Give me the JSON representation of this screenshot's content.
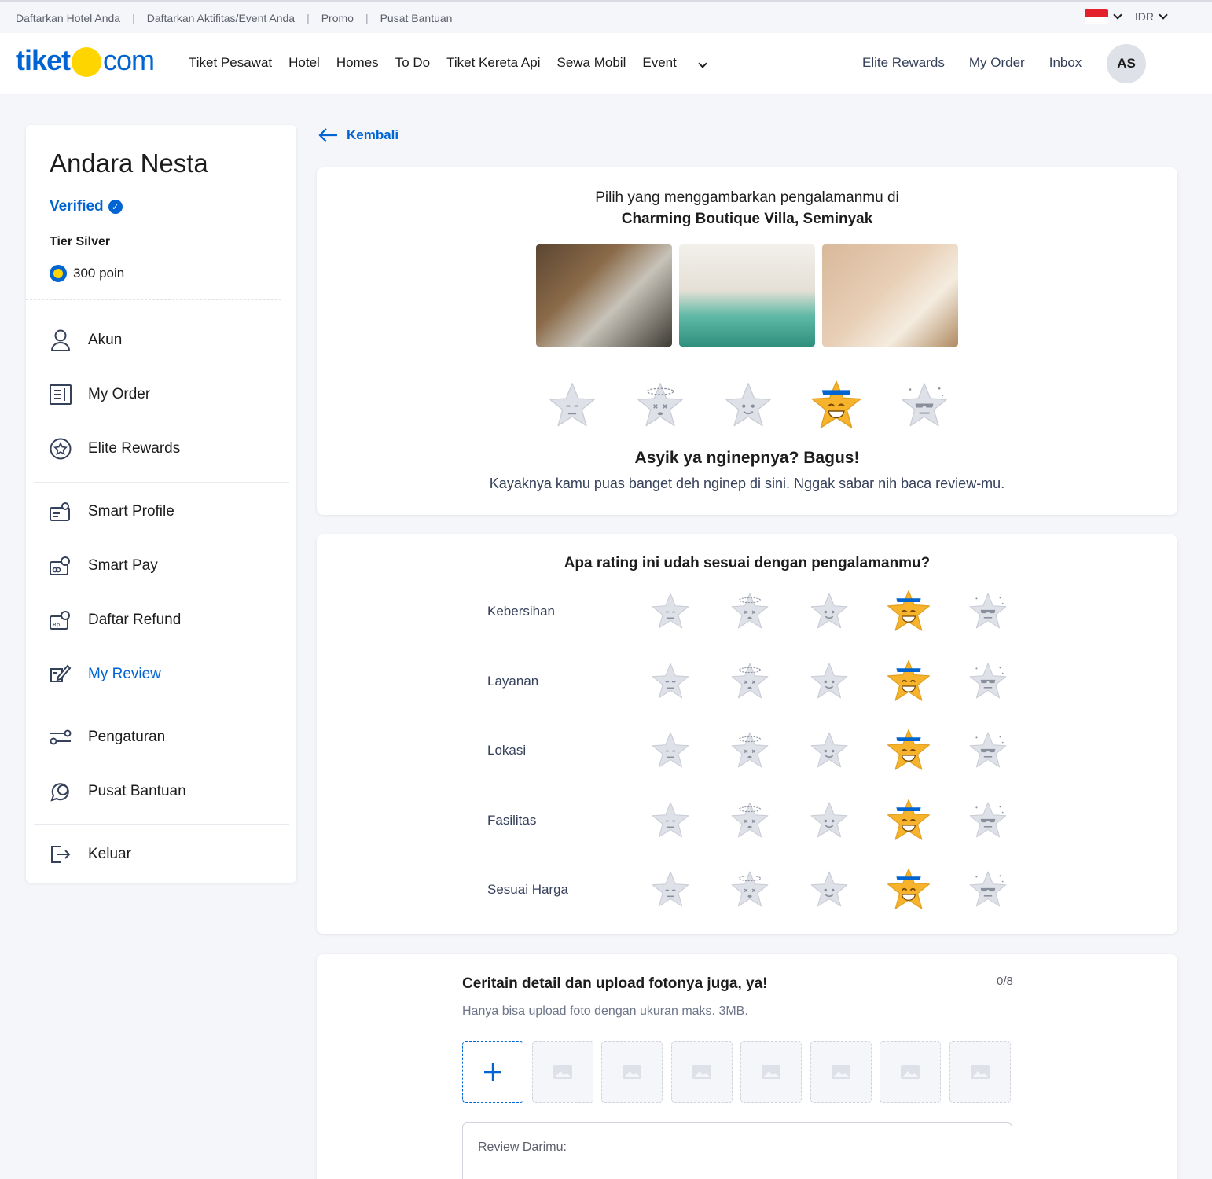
{
  "utilbar": {
    "links": [
      "Daftarkan Hotel Anda",
      "Daftarkan Aktifitas/Event Anda",
      "Promo",
      "Pusat  Bantuan"
    ],
    "currency": "IDR"
  },
  "nav": {
    "logo_left": "tiket",
    "logo_right": "com",
    "links": [
      "Tiket Pesawat",
      "Hotel",
      "Homes",
      "To Do",
      "Tiket Kereta Api",
      "Sewa Mobil",
      "Event"
    ],
    "right_links": [
      "Elite Rewards",
      "My Order",
      "Inbox"
    ],
    "avatar_initials": "AS"
  },
  "sidebar": {
    "name": "Andara Nesta",
    "verified": "Verified",
    "tier": "Tier Silver",
    "points": "300 poin",
    "items": [
      {
        "label": "Akun",
        "icon": "person-icon"
      },
      {
        "label": "My Order",
        "icon": "order-icon"
      },
      {
        "label": "Elite Rewards",
        "icon": "star-badge-icon"
      },
      {
        "label": "Smart Profile",
        "icon": "profile-card-icon"
      },
      {
        "label": "Smart Pay",
        "icon": "card-globe-icon"
      },
      {
        "label": "Daftar Refund",
        "icon": "refund-icon"
      },
      {
        "label": "My Review",
        "icon": "review-icon"
      },
      {
        "label": "Pengaturan",
        "icon": "sliders-icon"
      },
      {
        "label": "Pusat Bantuan",
        "icon": "chat-icon"
      },
      {
        "label": "Keluar",
        "icon": "logout-icon"
      }
    ],
    "active_item": "My Review"
  },
  "main": {
    "back_label": "Kembali",
    "experience": {
      "prompt": "Pilih yang menggambarkan pengalamanmu di",
      "property": "Charming Boutique Villa, Seminyak",
      "selected_rating": 4,
      "title": "Asyik ya nginepnya? Bagus!",
      "description": "Kayaknya kamu puas banget deh nginep di sini. Nggak sabar nih baca review-mu."
    },
    "ratings": {
      "title": "Apa rating ini udah sesuai dengan pengalamanmu?",
      "rows": [
        {
          "label": "Kebersihan",
          "value": 4
        },
        {
          "label": "Layanan",
          "value": 4
        },
        {
          "label": "Lokasi",
          "value": 4
        },
        {
          "label": "Fasilitas",
          "value": 4
        },
        {
          "label": "Sesuai Harga",
          "value": 4
        }
      ]
    },
    "upload": {
      "title": "Ceritain detail dan upload fotonya juga, ya!",
      "count": "0/8",
      "note": "Hanya bisa upload foto dengan ukuran maks. 3MB.",
      "review_label": "Review Darimu:"
    }
  },
  "colors": {
    "brand": "#0064d2",
    "accent_yellow": "#ffd500",
    "star_active": "#f7b32b",
    "star_inactive": "#dfe1e8"
  }
}
